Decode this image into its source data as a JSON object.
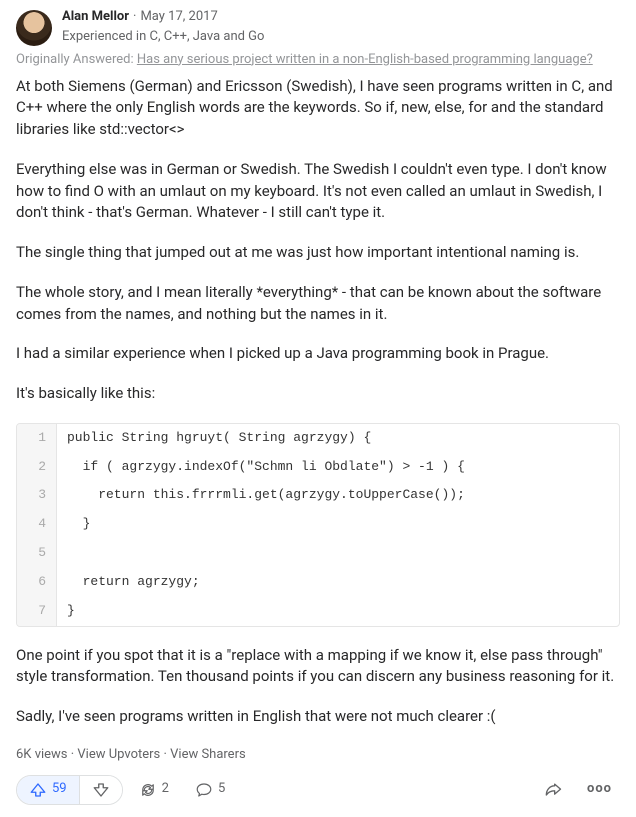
{
  "header": {
    "author": "Alan Mellor",
    "date": "May 17, 2017",
    "credential": "Experienced in C, C++, Java and Go"
  },
  "original": {
    "prefix": "Originally Answered: ",
    "question": "Has any serious project written in a non-English-based programming language?"
  },
  "paragraphs": {
    "p1": "At both Siemens (German) and Ericsson (Swedish), I have seen programs written in C, and C++ where the only English words are the keywords. So if, new, else, for and the standard libraries like std::vector<>",
    "p2": "Everything else was in German or Swedish. The Swedish I couldn't even type. I don't know how to find O with an umlaut on my keyboard. It's not even called an umlaut in Swedish, I don't think - that's German. Whatever - I still can't type it.",
    "p3": "The single thing that jumped out at me was just how important intentional naming is.",
    "p4": "The whole story, and I mean literally *everything* - that can be known about the software comes from the names, and nothing but the names in it.",
    "p5": "I had a similar experience when I picked up a Java programming book in Prague.",
    "p6": "It's basically like this:",
    "p7": "One point if you spot that it is a \"replace with a mapping if we know it, else pass through\" style transformation. Ten thousand points if you can discern any business reasoning for it.",
    "p8": "Sadly, I've seen programs written in English that were not much clearer :("
  },
  "code": {
    "l1": "public String hgruyt( String agrzygy) {",
    "l2": "  if ( agrzygy.indexOf(\"Schmn li Obdlate\") > -1 ) {",
    "l3": "    return this.frrrmli.get(agrzygy.toUpperCase());",
    "l4": "  }",
    "l5": " ",
    "l6": "  return agrzygy;",
    "l7": "}"
  },
  "ln": {
    "l1": "1",
    "l2": "2",
    "l3": "3",
    "l4": "4",
    "l5": "5",
    "l6": "6",
    "l7": "7"
  },
  "meta": {
    "views": "6K views",
    "upvoters": "View Upvoters",
    "sharers": "View Sharers",
    "sep": " · "
  },
  "actions": {
    "upvote_count": "59",
    "reshare_count": "2",
    "comment_count": "5"
  }
}
